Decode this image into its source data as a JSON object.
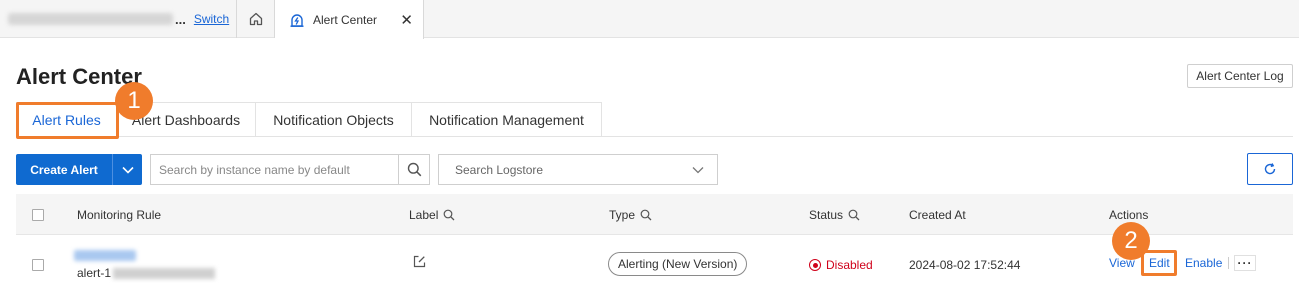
{
  "topbar": {
    "project_name_ellipsis": "...",
    "switch_label": "Switch",
    "active_tab_label": "Alert Center",
    "close_symbol": "✕"
  },
  "header": {
    "title": "Alert Center",
    "log_button": "Alert Center Log"
  },
  "tabs": [
    {
      "label": "Alert Rules",
      "active": true
    },
    {
      "label": "Alert Dashboards",
      "active": false
    },
    {
      "label": "Notification Objects",
      "active": false
    },
    {
      "label": "Notification Management",
      "active": false
    }
  ],
  "toolbar": {
    "create_label": "Create Alert",
    "search_placeholder": "Search by instance name by default",
    "logstore_placeholder": "Search Logstore"
  },
  "table": {
    "columns": [
      "Monitoring Rule",
      "Label",
      "Type",
      "Status",
      "Created At",
      "Actions"
    ],
    "rows": [
      {
        "rule_id_prefix": "alert-1",
        "type": "Alerting (New Version)",
        "status": "Disabled",
        "created_at": "2024-08-02 17:52:44",
        "actions": {
          "view": "View",
          "edit": "Edit",
          "enable": "Enable",
          "more": "···"
        }
      }
    ]
  },
  "annotations": {
    "step1": "1",
    "step2": "2"
  },
  "colors": {
    "accent": "#1a66d6",
    "primary_button": "#0f6ad0",
    "annotation": "#f07c2c",
    "disabled": "#d0021b"
  },
  "icons": [
    "home-icon",
    "alert-center-tab-icon",
    "close-icon",
    "chevron-down-icon",
    "search-icon",
    "refresh-icon",
    "edit-label-icon",
    "disabled-status-icon",
    "more-icon"
  ]
}
